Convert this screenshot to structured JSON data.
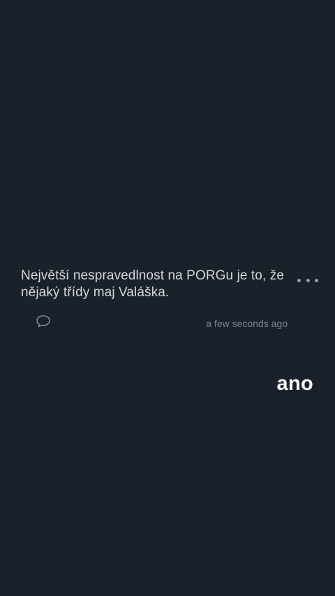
{
  "post": {
    "text": "Největší nespravedlnost na PORGu je to, že nějaký třídy maj Valáška.",
    "timestamp": "a few seconds ago",
    "more_icon": "more-horizontal-icon",
    "comment_icon": "comment-bubble-icon"
  },
  "reply": {
    "text": "ano"
  },
  "colors": {
    "background": "#1b212b",
    "post_text": "#d3d6dc",
    "meta_text": "#7e848e",
    "reply_text": "#ffffff"
  }
}
